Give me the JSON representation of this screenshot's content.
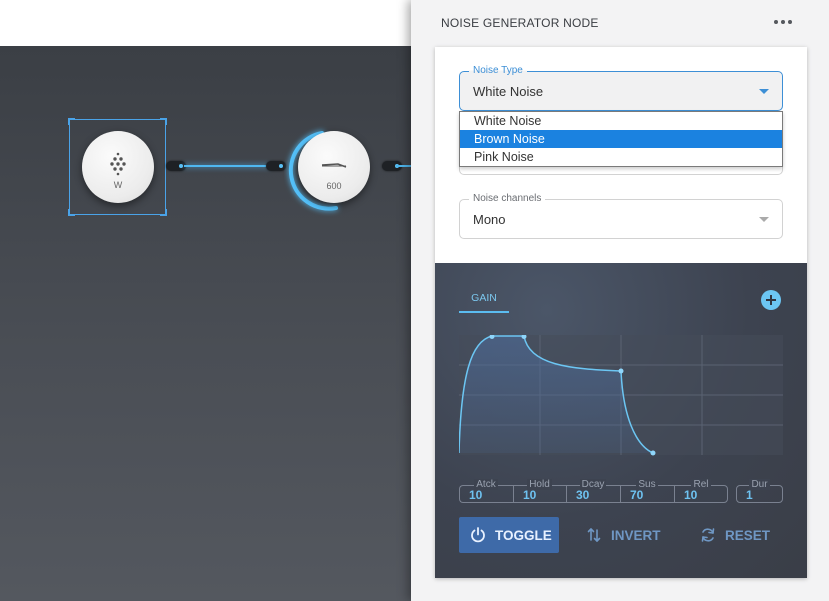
{
  "canvas": {
    "node_w": {
      "label": "W"
    },
    "node_600": {
      "label": "600"
    }
  },
  "panel": {
    "title": "NOISE GENERATOR NODE",
    "noise_type": {
      "legend": "Noise Type",
      "value": "White Noise",
      "options": [
        "White Noise",
        "Brown Noise",
        "Pink Noise"
      ],
      "highlighted": "Brown Noise"
    },
    "noise_channels": {
      "legend": "Noise channels",
      "value": "Mono"
    },
    "envelope": {
      "tab": "GAIN",
      "params": [
        {
          "label": "Atck",
          "value": "10"
        },
        {
          "label": "Hold",
          "value": "10"
        },
        {
          "label": "Dcay",
          "value": "30"
        },
        {
          "label": "Sus",
          "value": "70"
        },
        {
          "label": "Rel",
          "value": "10"
        },
        {
          "label": "Dur",
          "value": "1"
        }
      ],
      "actions": {
        "toggle": "TOGGLE",
        "invert": "INVERT",
        "reset": "RESET"
      }
    }
  },
  "colors": {
    "accent": "#3d8fd6",
    "highlight": "#1b82e0",
    "envelope_line": "#6cc6f3",
    "toggle_bg": "#3e6aa8"
  }
}
